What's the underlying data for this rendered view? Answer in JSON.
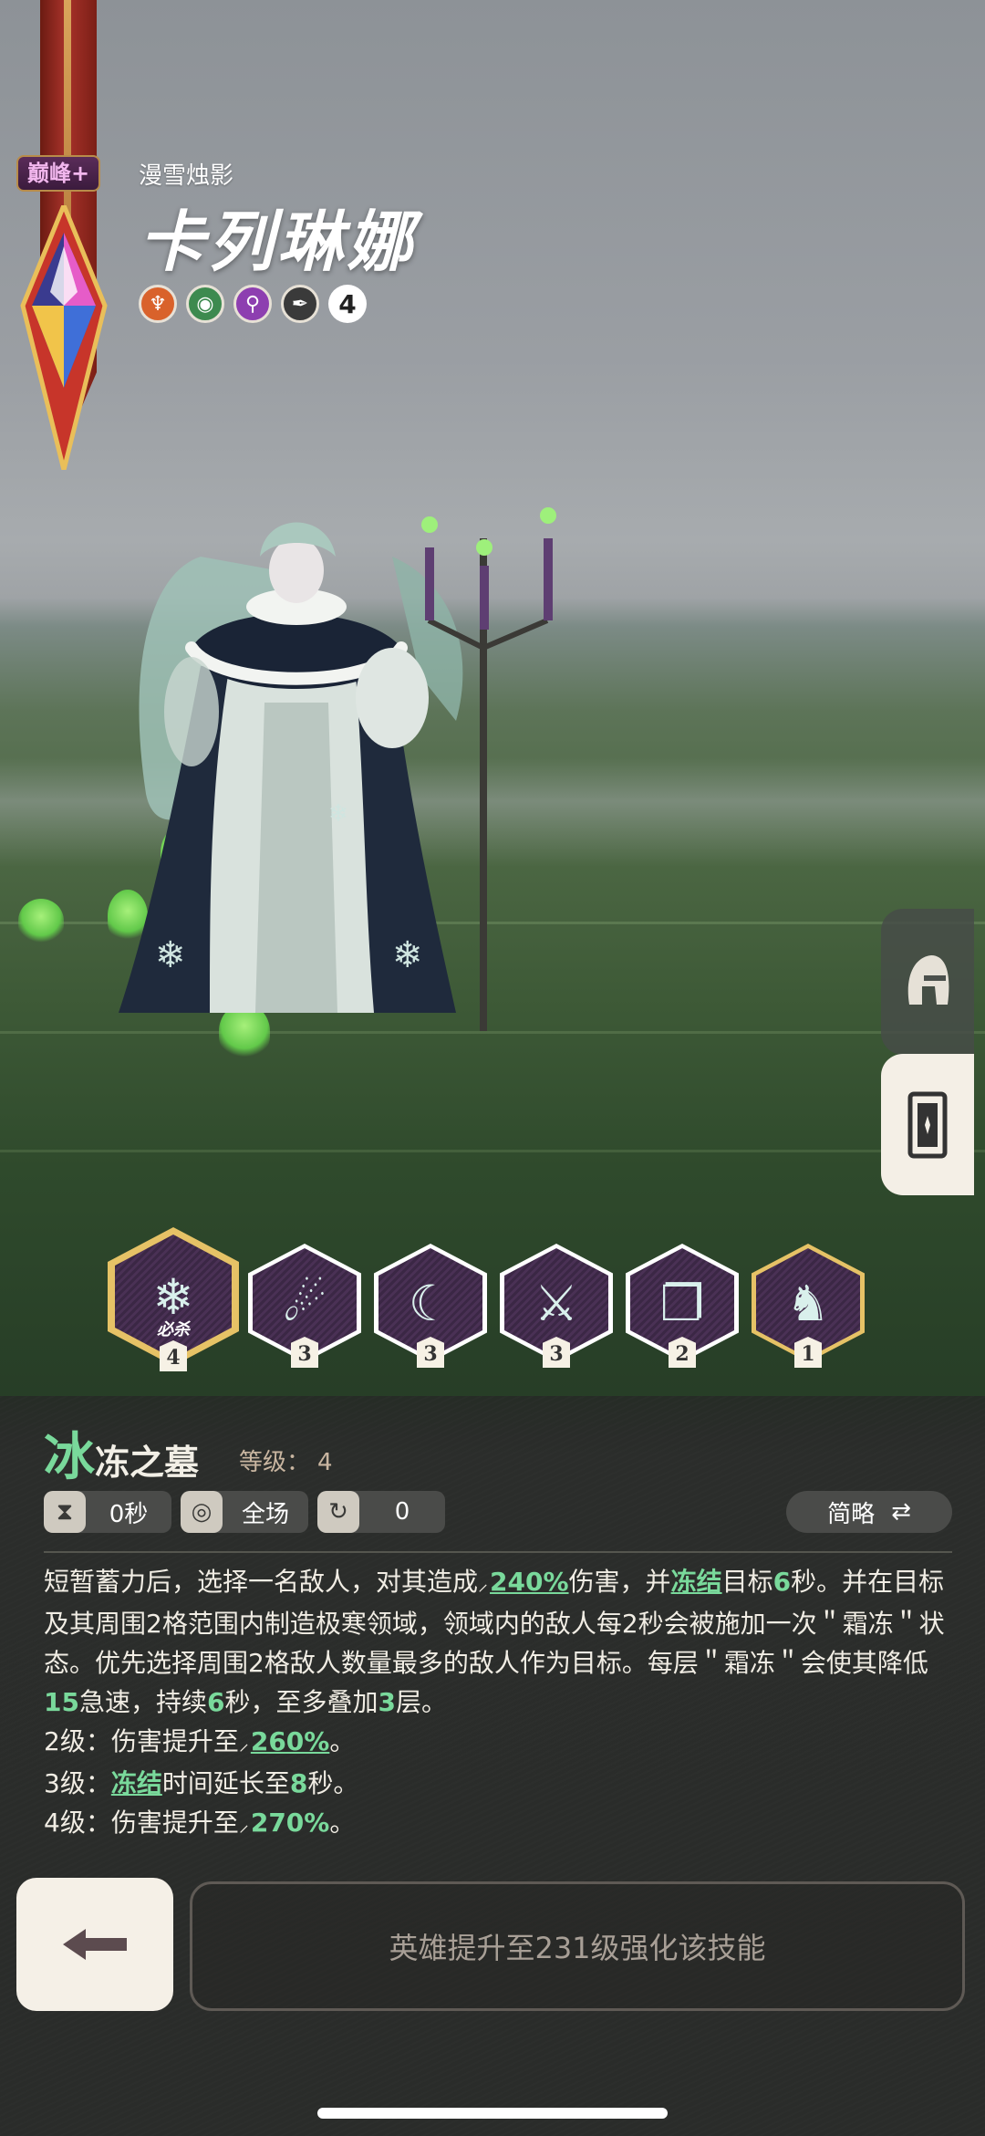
{
  "hero": {
    "rank_badge": "巅峰+",
    "subtitle": "漫雪烛影",
    "name": "卡列琳娜",
    "trait_count": "4",
    "trait_icons": [
      "trident-icon",
      "eye-icon",
      "magic-orb-icon",
      "feather-icon"
    ],
    "trait_colors": [
      "#d9622b",
      "#3d8a4f",
      "#8d3fb0",
      "#3a3a3a"
    ]
  },
  "side_tabs": [
    {
      "name": "helmet-icon"
    },
    {
      "name": "card-icon"
    }
  ],
  "skills": [
    {
      "name": "frost-tomb-skill",
      "level": "4",
      "ult_tag": "必杀",
      "selected": true
    },
    {
      "name": "ice-shard-skill",
      "level": "3"
    },
    {
      "name": "comet-skill",
      "level": "3"
    },
    {
      "name": "ice-blade-skill",
      "level": "3"
    },
    {
      "name": "spellbook-skill",
      "level": "2"
    },
    {
      "name": "knight-skill",
      "level": "1"
    }
  ],
  "detail": {
    "title_first": "冰",
    "title_rest": "冻之墓",
    "level_label": "等级：",
    "level_value": "4",
    "stats": {
      "cooldown": "0秒",
      "range": "全场",
      "energy": "0"
    },
    "summary_label": "简略",
    "description": {
      "l1a": "短暂蓄力后，选择一名敌人，对其造成",
      "l1b": "240%",
      "l1c": "伤害，并",
      "l1d": "冻结",
      "l1e": "目标",
      "l2a": "6",
      "l2b": "秒。并在目标及其周围2格范围内制造极寒领域，领域内的敌人每2秒会被施加一次＂霜冻＂状态。优先选择周围2格敌人数量最多的敌人作为目标。每层＂霜冻＂会使其降低",
      "l2c": "15",
      "l2d": "急速，持续",
      "l2e": "6",
      "l2f": "秒，至多叠加",
      "l2g": "3",
      "l2h": "层。"
    },
    "upgrades": [
      {
        "prefix": "2级：伤害提升至",
        "value": "260%",
        "suffix": "。"
      },
      {
        "prefix": "3级：",
        "keyword": "冻结",
        "mid": "时间延长至",
        "value": "8",
        "suffix": "秒。"
      },
      {
        "prefix": "4级：伤害提升至",
        "value": "270%",
        "suffix": "。"
      }
    ]
  },
  "footer": {
    "back_icon": "back-arrow-icon",
    "upgrade_label": "英雄提升至231级强化该技能"
  }
}
